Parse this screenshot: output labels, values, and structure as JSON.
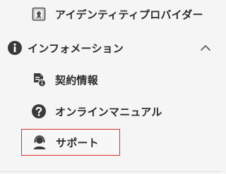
{
  "sidebar": {
    "items": [
      {
        "label": "アイデンティティプロバイダー",
        "icon": "certificate-icon"
      },
      {
        "label": "インフォメーション",
        "icon": "info-circle-icon",
        "expanded": true
      },
      {
        "label": "契約情報",
        "icon": "contract-info-icon"
      },
      {
        "label": "オンラインマニュアル",
        "icon": "help-circle-icon"
      },
      {
        "label": "サポート",
        "icon": "support-agent-icon",
        "selected": true
      }
    ]
  },
  "colors": {
    "background": "#f5f5f5",
    "text": "#2b2b2b",
    "icon": "#3a3a3a",
    "highlight_border": "#d8312f"
  }
}
